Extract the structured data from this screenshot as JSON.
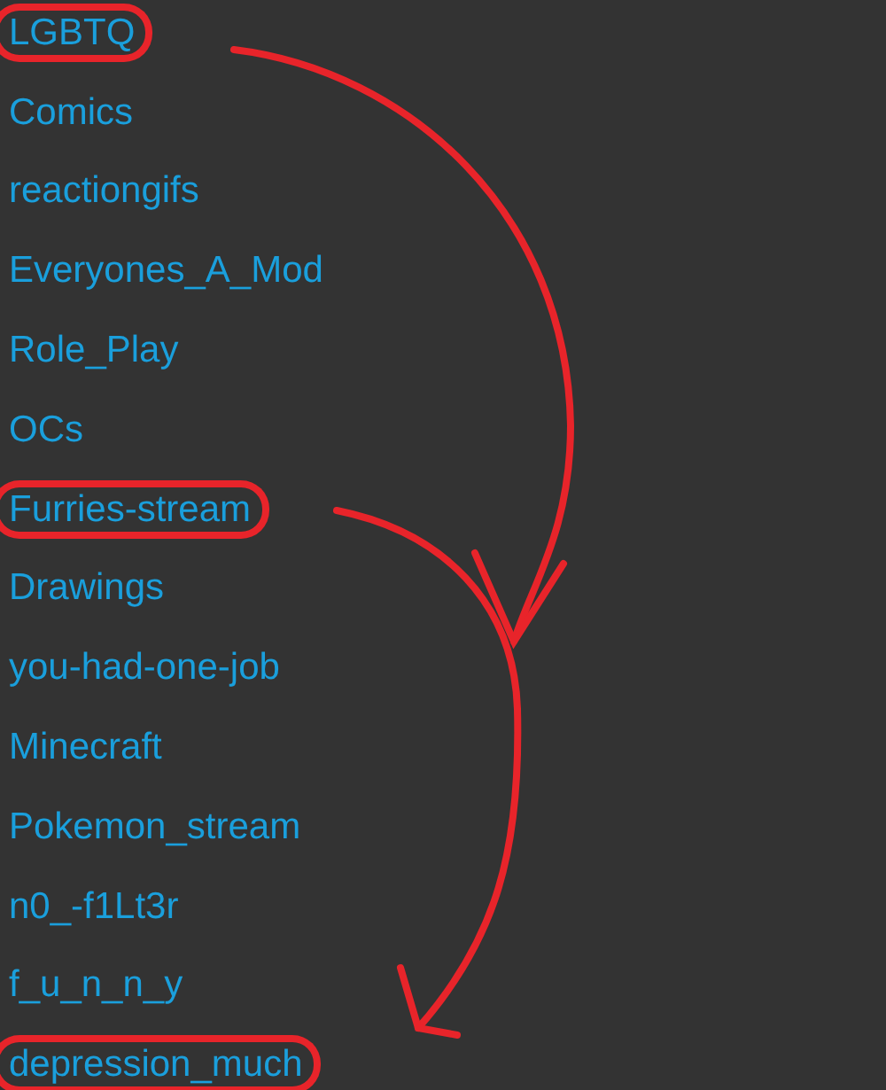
{
  "streams": [
    {
      "name": "LGBTQ",
      "circled": true
    },
    {
      "name": "Comics",
      "circled": false
    },
    {
      "name": "reactiongifs",
      "circled": false
    },
    {
      "name": "Everyones_A_Mod",
      "circled": false
    },
    {
      "name": "Role_Play",
      "circled": false
    },
    {
      "name": "OCs",
      "circled": false
    },
    {
      "name": "Furries-stream",
      "circled": true
    },
    {
      "name": "Drawings",
      "circled": false
    },
    {
      "name": "you-had-one-job",
      "circled": false
    },
    {
      "name": "Minecraft",
      "circled": false
    },
    {
      "name": "Pokemon_stream",
      "circled": false
    },
    {
      "name": "n0_-f1Lt3r",
      "circled": false
    },
    {
      "name": "f_u_n_n_y",
      "circled": false
    },
    {
      "name": "depression_much",
      "circled": true
    }
  ]
}
